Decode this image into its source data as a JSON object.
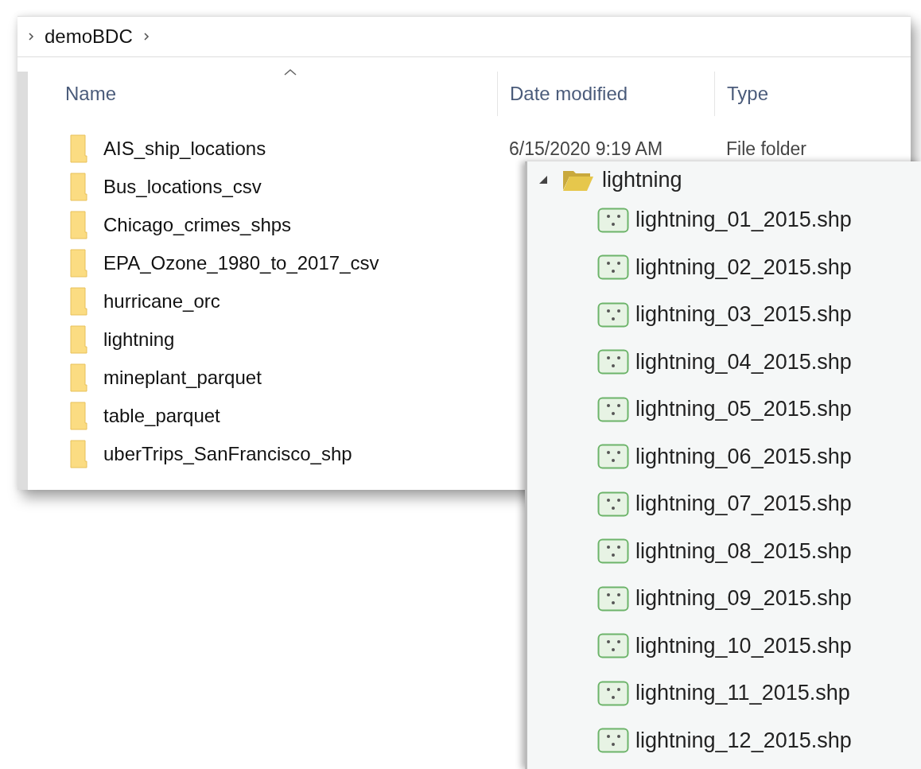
{
  "breadcrumb": [
    {
      "label": "demoBDC"
    }
  ],
  "columns": [
    {
      "label": "Name",
      "sorted": true
    },
    {
      "label": "Date modified",
      "sorted": false
    },
    {
      "label": "Type",
      "sorted": false
    }
  ],
  "rows": [
    {
      "name": "AIS_ship_locations",
      "date": "6/15/2020 9:19 AM",
      "type": "File folder"
    },
    {
      "name": "Bus_locations_csv"
    },
    {
      "name": "Chicago_crimes_shps"
    },
    {
      "name": "EPA_Ozone_1980_to_2017_csv"
    },
    {
      "name": "hurricane_orc"
    },
    {
      "name": "lightning"
    },
    {
      "name": "mineplant_parquet"
    },
    {
      "name": "table_parquet"
    },
    {
      "name": "uberTrips_SanFrancisco_shp"
    }
  ],
  "tree": {
    "label": "lightning",
    "expanded": true,
    "children": [
      {
        "label": "lightning_01_2015.shp"
      },
      {
        "label": "lightning_02_2015.shp"
      },
      {
        "label": "lightning_03_2015.shp"
      },
      {
        "label": "lightning_04_2015.shp"
      },
      {
        "label": "lightning_05_2015.shp"
      },
      {
        "label": "lightning_06_2015.shp"
      },
      {
        "label": "lightning_07_2015.shp"
      },
      {
        "label": "lightning_08_2015.shp"
      },
      {
        "label": "lightning_09_2015.shp"
      },
      {
        "label": "lightning_10_2015.shp"
      },
      {
        "label": "lightning_11_2015.shp"
      },
      {
        "label": "lightning_12_2015.shp"
      }
    ]
  }
}
